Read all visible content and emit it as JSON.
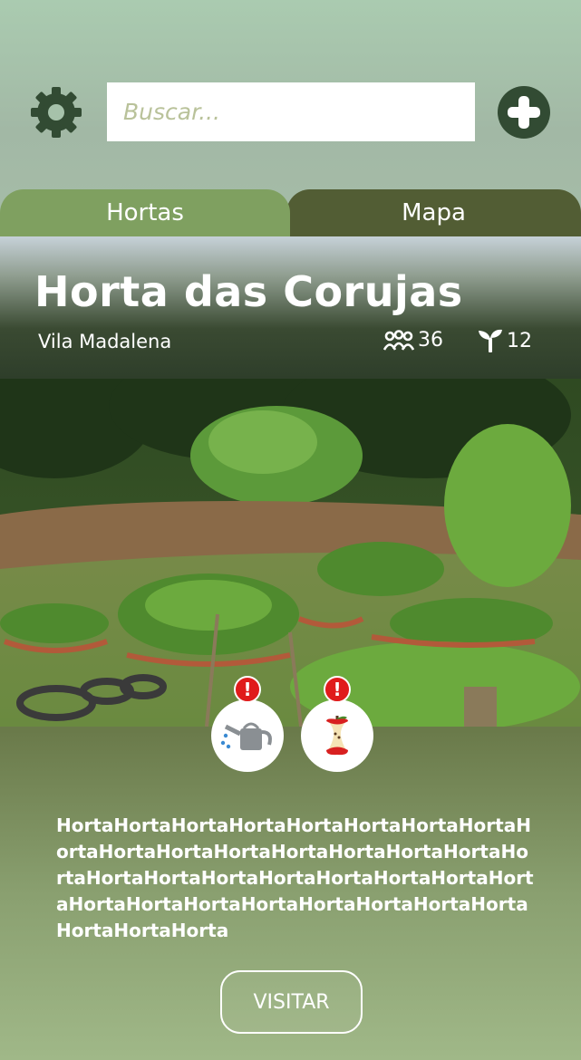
{
  "search": {
    "placeholder": "Buscar..."
  },
  "tabs": [
    {
      "label": "Hortas",
      "active": true
    },
    {
      "label": "Mapa",
      "active": false
    }
  ],
  "garden": {
    "title": "Horta das Corujas",
    "neighborhood": "Vila Madalena",
    "members": "36",
    "plants": "12",
    "description": "HortaHortaHortaHortaHortaHortaHortaHortaHortaHortaHortaHortaHortaHortaHortaHortaHortaHortaHortaHortaHortaHortaHortaHortaHortaHortaHortaHortaHortaHortaHortaHortaHortaHortaHortaHorta",
    "visit_label": "VISITAR",
    "alerts": [
      {
        "icon": "watering-can-icon",
        "mark": "!"
      },
      {
        "icon": "apple-core-icon",
        "mark": "!"
      }
    ]
  },
  "colors": {
    "accent_dark": "#324b33",
    "tab_active": "#7fa060",
    "tab_inactive": "#525d34",
    "alert": "#e01b1b"
  }
}
